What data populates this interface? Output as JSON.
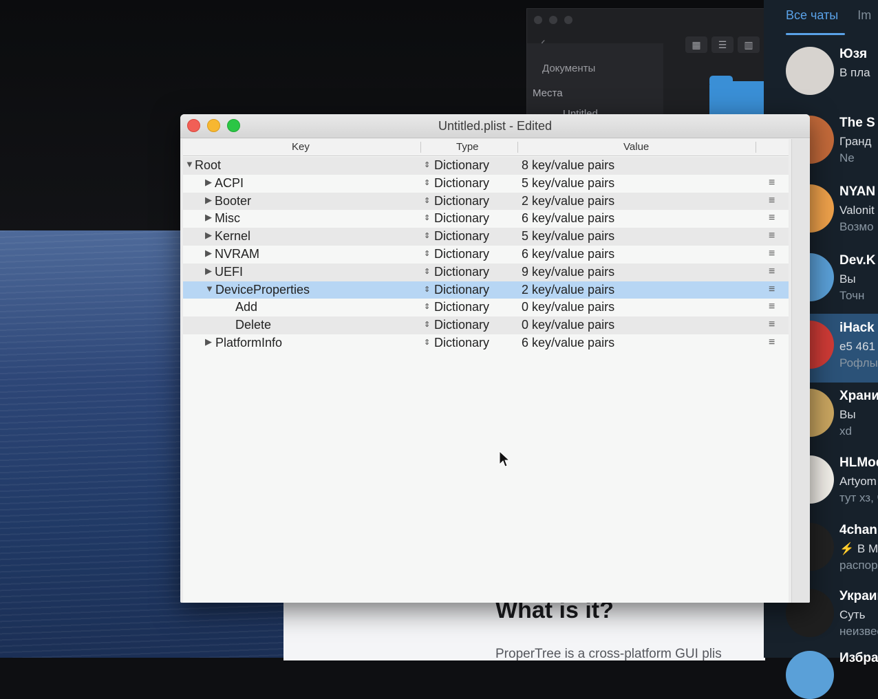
{
  "window": {
    "title": "Untitled.plist - Edited"
  },
  "columns": {
    "key": "Key",
    "type": "Type",
    "value": "Value"
  },
  "rows": [
    {
      "key": "Root",
      "expanded": true,
      "type": "Dictionary",
      "value": "8 key/value pairs"
    },
    {
      "key": "ACPI",
      "expanded": false,
      "type": "Dictionary",
      "value": "5 key/value pairs"
    },
    {
      "key": "Booter",
      "expanded": false,
      "type": "Dictionary",
      "value": "2 key/value pairs"
    },
    {
      "key": "Misc",
      "expanded": false,
      "type": "Dictionary",
      "value": "6 key/value pairs"
    },
    {
      "key": "Kernel",
      "expanded": false,
      "type": "Dictionary",
      "value": "5 key/value pairs"
    },
    {
      "key": "NVRAM",
      "expanded": false,
      "type": "Dictionary",
      "value": "6 key/value pairs"
    },
    {
      "key": "UEFI",
      "expanded": false,
      "type": "Dictionary",
      "value": "9 key/value pairs"
    },
    {
      "key": "DeviceProperties",
      "expanded": true,
      "selected": true,
      "type": "Dictionary",
      "value": "2 key/value pairs"
    },
    {
      "key": "Add",
      "type": "Dictionary",
      "value": "0 key/value pairs"
    },
    {
      "key": "Delete",
      "type": "Dictionary",
      "value": "0 key/value pairs"
    },
    {
      "key": "PlatformInfo",
      "expanded": false,
      "type": "Dictionary",
      "value": "6 key/value pairs"
    }
  ],
  "finder": {
    "documents_label": "Документы",
    "places_label": "Места",
    "untitled_label": "Untitled"
  },
  "webpage": {
    "heading": "What is it?",
    "text": "ProperTree is a cross-platform GUI plis"
  },
  "telegram": {
    "tab_all": "Все чаты",
    "tab_other": "Im",
    "chats": [
      {
        "name": "Юзя",
        "line1": "В пла",
        "line2": ""
      },
      {
        "name": "The S",
        "line1": "Гранд",
        "line2": "Ne"
      },
      {
        "name": "NYAN",
        "line1": "Valonit",
        "line2": "Возмо"
      },
      {
        "name": "Dev.K",
        "line1": "Вы",
        "line2": "Точн"
      },
      {
        "name": "iHack",
        "line1": "e5 461",
        "line2": "Рофлы"
      },
      {
        "name": "Храни",
        "line1": "Вы",
        "line2": "xd"
      },
      {
        "name": "HLMod",
        "line1": "Artyom",
        "line2": "тут хз, ч"
      },
      {
        "name": "4chan",
        "line1": "⚡ В Ми",
        "line2": "распоря"
      },
      {
        "name": "Украин",
        "line1": "Суть",
        "line2": "неизвест"
      },
      {
        "name": "Избран",
        "line1": "",
        "line2": ""
      }
    ]
  },
  "colors": {
    "selection": "#b7d6f4",
    "telegram_accent": "#5aa2e8",
    "telegram_bg": "#17212b"
  }
}
